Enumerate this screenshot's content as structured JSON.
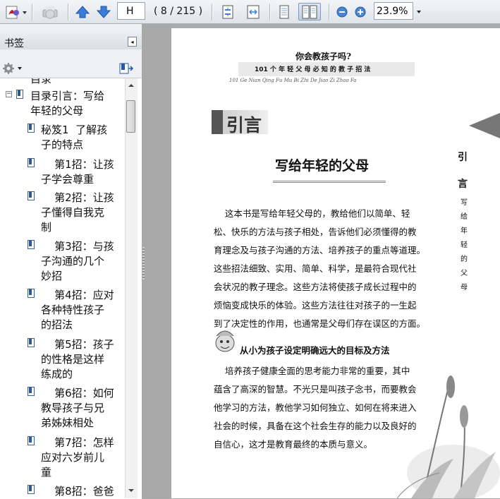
{
  "toolbar": {
    "page_input": "H",
    "page_count": "( 8 / 215 )",
    "zoom": "23.9%",
    "icons": [
      "create-pdf-icon",
      "print-icon",
      "prev-page-icon",
      "next-page-icon",
      "fit-page-icon",
      "fit-width-icon",
      "single-page-icon",
      "two-page-icon",
      "zoom-out-icon",
      "zoom-in-icon"
    ]
  },
  "sidebar": {
    "title": "书签",
    "items": [
      {
        "label": "目录"
      },
      {
        "label": "目录引言：写给\n年轻的父母"
      },
      {
        "label": "秘笈1  了解孩\n子的特点"
      },
      {
        "label": "    第1招：让孩\n子学会尊重"
      },
      {
        "label": "    第2招：让孩\n子懂得自我克\n制"
      },
      {
        "label": "    第3招：与孩\n子沟通的几个\n妙招"
      },
      {
        "label": "    第4招：应对\n各种特性孩子\n的招法"
      },
      {
        "label": "    第5招：孩子\n的性格是这样\n练成的"
      },
      {
        "label": "    第6招：如何\n教导孩子与兄\n弟姊妹相处"
      },
      {
        "label": "    第7招：怎样\n应对六岁前儿\n童"
      },
      {
        "label": "    第8招：爸爸"
      }
    ]
  },
  "document": {
    "header_title": "你会教孩子吗?",
    "header_subtitle": "101 个 年 轻 父 母 必 知 的 教 子 招 法",
    "header_pinyin": "101 Ge Nian Qing Fu Mu Bi Zhi De Jiao Zi Zhao Fa",
    "chapter_label": "引言",
    "side_tab_1": "引",
    "side_tab_2": "言",
    "side_vertical": "写\n给\n年\n轻\n的\n父\n母",
    "section_title": "写给年轻的父母",
    "paragraph_lines": [
      "    这本书是写给年轻父母的，教给他们以简单、轻",
      "松、快乐的方法与孩子相处，告诉他们必须懂得的教",
      "育理念及与孩子沟通的方法、培养孩子的重点等道理。",
      "这些招法细致、实用、简单、科学，是最符合现代社",
      "会状况的教子理念。这些方法将使孩子成长过程中的",
      "烦恼变成快乐的体验。这些方法往往对孩子的一生起",
      "到了决定性的作用，也通常是父母们存在误区的方面。"
    ],
    "subheading": "从小为孩子设定明确远大的目标及方法",
    "sub_lines": [
      "    培养孩子健康全面的思考能力非常的重要，其中",
      "蕴含了高深的智慧。不光只是叫孩子念书，而要教会",
      "他学习的方法，教他学习如何独立、如何在将来进入",
      "社会的时候，具备在这个社会生存的能力以及良好的",
      "自信心，这才是教育最终的本质与意义。"
    ]
  }
}
